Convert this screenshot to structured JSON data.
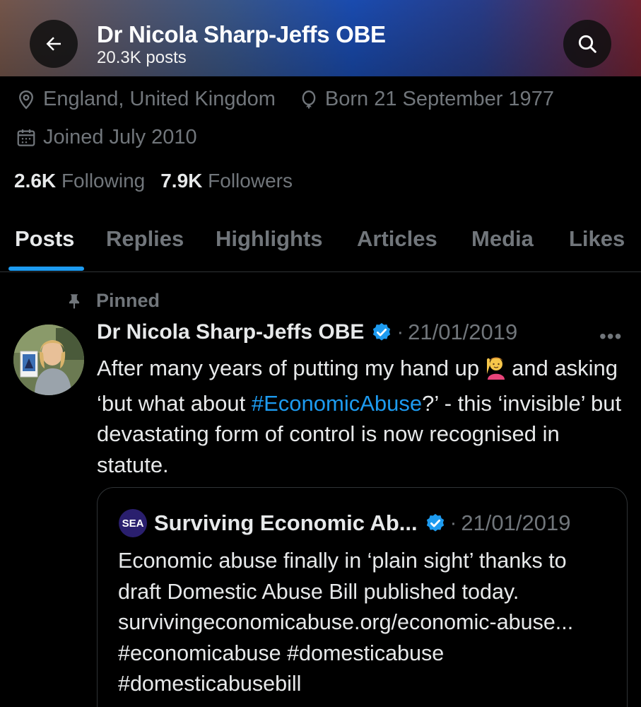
{
  "header": {
    "title": "Dr Nicola Sharp-Jeffs OBE",
    "post_count": "20.3K posts"
  },
  "profile": {
    "location": "England, United Kingdom",
    "born": "Born 21 September 1977",
    "joined": "Joined July 2010",
    "following_count": "2.6K",
    "following_label": "Following",
    "followers_count": "7.9K",
    "followers_label": "Followers"
  },
  "tabs": [
    {
      "label": "Posts",
      "active": true
    },
    {
      "label": "Replies"
    },
    {
      "label": "Highlights"
    },
    {
      "label": "Articles"
    },
    {
      "label": "Media"
    },
    {
      "label": "Likes"
    }
  ],
  "pinned_post": {
    "pinned_label": "Pinned",
    "author": "Dr Nicola Sharp-Jeffs OBE",
    "separator": "·",
    "date": "21/01/2019",
    "more": "•••",
    "text_1": "After many years of putting my hand up",
    "text_2": "and asking ‘but what about",
    "hashtag": "#EconomicAbuse",
    "text_3": "?’ - this ‘invisible’ but devastating form of control is now recognised in statute.",
    "quoted": {
      "avatar_text": "SEA",
      "author": "Surviving Economic Ab...",
      "separator": "·",
      "date": "21/01/2019",
      "text": "Economic abuse finally in ‘plain sight’ thanks to draft Domestic Abuse Bill published today. survivingeconomicabuse.org/economic-abuse... #economicabuse #domesticabuse #domesticabusebill"
    }
  },
  "colors": {
    "accent": "#1d9bf0",
    "muted": "#71767b",
    "background": "#000000",
    "text": "#e7e9ea"
  },
  "icons": [
    "back-arrow-icon",
    "search-icon",
    "location-pin-icon",
    "birthday-balloon-icon",
    "calendar-icon",
    "pin-icon",
    "verified-badge-icon",
    "raising-hand-emoji-icon"
  ]
}
